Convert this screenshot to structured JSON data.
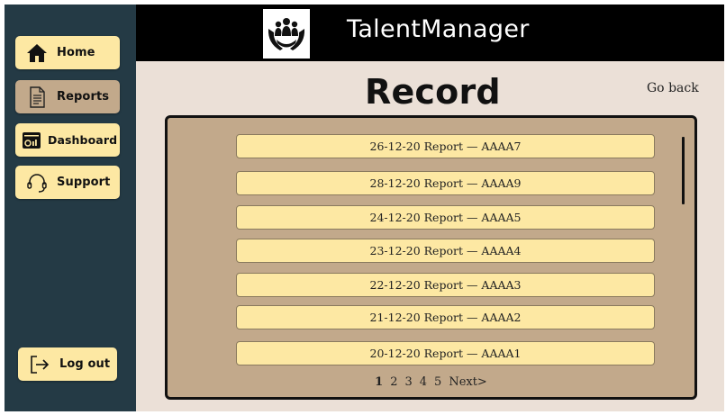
{
  "app": {
    "title": "TalentManager"
  },
  "sidebar": {
    "items": [
      {
        "label": "Home",
        "icon": "home-icon",
        "active": false
      },
      {
        "label": "Reports",
        "icon": "document-icon",
        "active": true
      },
      {
        "label": "Dashboard",
        "icon": "dashboard-icon",
        "active": false
      },
      {
        "label": "Support",
        "icon": "headset-icon",
        "active": false
      }
    ],
    "logout": {
      "label": "Log out",
      "icon": "logout-icon"
    }
  },
  "main": {
    "title": "Record",
    "go_back": "Go back",
    "reports": [
      "26-12-20 Report — AAAA7",
      "28-12-20 Report — AAAA9",
      "24-12-20 Report — AAAA5",
      "23-12-20 Report — AAAA4",
      "22-12-20 Report — AAAA3",
      "21-12-20 Report — AAAA2",
      "20-12-20 Report — AAAA1"
    ],
    "pagination": {
      "pages": [
        "1",
        "2",
        "3",
        "4",
        "5"
      ],
      "current": "1",
      "next": "Next>"
    }
  },
  "colors": {
    "sidebar_bg": "#243a45",
    "button_bg": "#fde8a3",
    "active_button_bg": "#c2a98b",
    "header_bg": "#000000",
    "main_bg": "#ebe0d7",
    "panel_bg": "#c2a98b"
  }
}
